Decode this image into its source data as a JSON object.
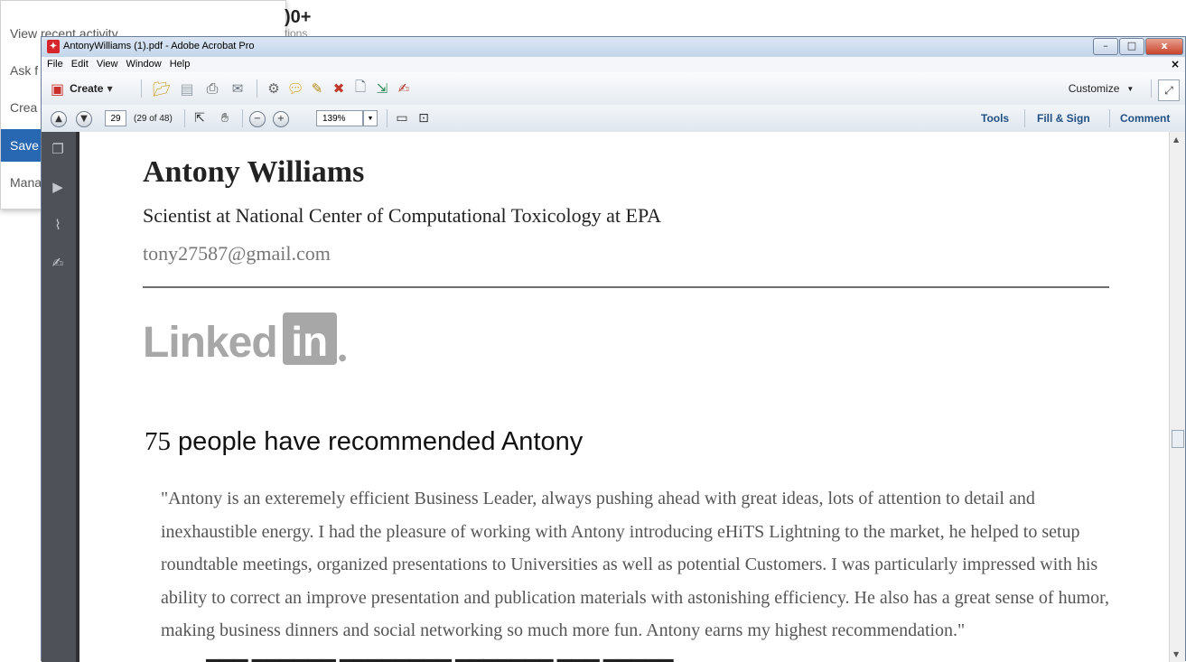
{
  "background": {
    "menu_items": [
      "View recent activity",
      "Ask f",
      "Crea",
      "Save",
      "Mana"
    ],
    "stat": ")0+",
    "stat_sub": "tions"
  },
  "window": {
    "title": "AntonyWilliams (1).pdf - Adobe Acrobat Pro",
    "controls": {
      "minimize": "–",
      "maximize": "□",
      "close": "x"
    }
  },
  "menubar": {
    "items": [
      "File",
      "Edit",
      "View",
      "Window",
      "Help"
    ],
    "close_doc": "×"
  },
  "toolbar": {
    "create_label": "Create",
    "customize_label": "Customize"
  },
  "navbar": {
    "page_number": "29",
    "page_of": "(29 of 48)",
    "zoom": "139%",
    "tools_label": "Tools",
    "fill_sign_label": "Fill & Sign",
    "comment_label": "Comment"
  },
  "document": {
    "name": "Antony Williams",
    "headline": "Scientist at National Center of Computational Toxicology at EPA",
    "email": "tony27587@gmail.com",
    "logo_word": "Linked",
    "logo_box": "in",
    "recommend_count": "75",
    "recommend_text": " people have recommended Antony",
    "quote": "\"Antony is an exteremely efficient Business Leader, always pushing ahead with great ideas, lots of attention to detail and inexhaustible energy. I had the pleasure of working with Antony introducing eHiTS Lightning to the market, he helped to setup roundtable meetings, organized presentations to Universities as well as potential Customers. I was particularly impressed with his ability to correct an improve presentation and publication materials with astonishing efficiency. He also has a great sense of humor, making business dinners and social networking so much more fun. Antony earns my highest recommendation.\""
  },
  "colors": {
    "accent_menu": "#2867b2",
    "link_blue": "#1f4f83",
    "nav_pane": "#4e5157",
    "logo_gray": "#a7a7a7"
  }
}
